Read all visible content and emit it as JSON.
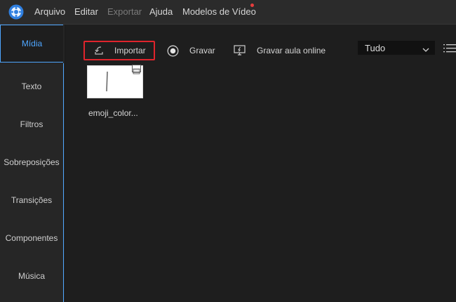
{
  "menubar": {
    "items": [
      "Arquivo",
      "Editar",
      "Exportar",
      "Ajuda",
      "Modelos de Vídeo"
    ]
  },
  "sidebar": {
    "items": [
      "Mídia",
      "Texto",
      "Filtros",
      "Sobreposições",
      "Transições",
      "Componentes",
      "Música"
    ],
    "active_index": 0
  },
  "toolbar": {
    "import_label": "Importar",
    "record_label": "Gravar",
    "online_class_label": "Gravar aula online"
  },
  "filter": {
    "selected": "Tudo"
  },
  "media": {
    "items": [
      {
        "name": "emoji_color..."
      }
    ]
  },
  "colors": {
    "accent": "#4ea6ff",
    "highlight": "#e0242c",
    "background": "#1e1e1e"
  }
}
